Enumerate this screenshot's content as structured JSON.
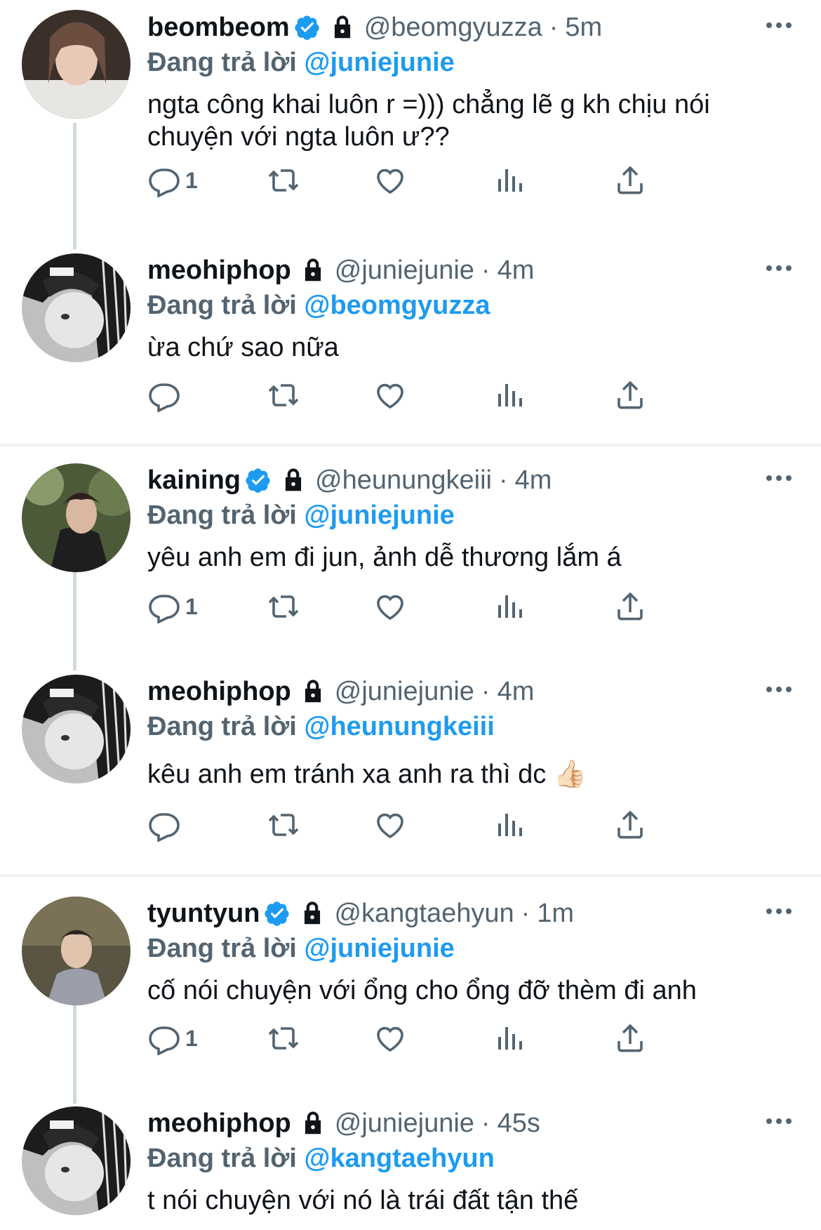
{
  "tweets": [
    {
      "name": "beombeom",
      "verified": true,
      "handle": "@beomgyuzza",
      "time": "5m",
      "replying_prefix": "Đang trả lời",
      "replying_to": "@juniejunie",
      "text": "ngta công khai luôn r =))) chẳng lẽ g kh chịu nói chuyện với ngta luôn ư??",
      "reply_count": "1"
    },
    {
      "name": "meohiphop",
      "verified": false,
      "handle": "@juniejunie",
      "time": "4m",
      "replying_prefix": "Đang trả lời",
      "replying_to": "@beomgyuzza",
      "text": "ừa chứ sao nữa",
      "reply_count": ""
    },
    {
      "name": "kaining",
      "verified": true,
      "handle": "@heunungkeiii",
      "time": "4m",
      "replying_prefix": "Đang trả lời",
      "replying_to": "@juniejunie",
      "text": "yêu anh em đi jun, ảnh dễ thương lắm á",
      "reply_count": "1"
    },
    {
      "name": "meohiphop",
      "verified": false,
      "handle": "@juniejunie",
      "time": "4m",
      "replying_prefix": "Đang trả lời",
      "replying_to": "@heunungkeiii",
      "text": "kêu anh em tránh xa anh ra thì dc 👍🏻",
      "reply_count": ""
    },
    {
      "name": "tyuntyun",
      "verified": true,
      "handle": "@kangtaehyun",
      "time": "1m",
      "replying_prefix": "Đang trả lời",
      "replying_to": "@juniejunie",
      "text": "cố nói chuyện với ổng cho ổng đỡ thèm đi anh",
      "reply_count": "1"
    },
    {
      "name": "meohiphop",
      "verified": false,
      "handle": "@juniejunie",
      "time": "45s",
      "replying_prefix": "Đang trả lời",
      "replying_to": "@kangtaehyun",
      "text": "t nói chuyện với nó là trái đất tận thế",
      "reply_count": ""
    }
  ],
  "colors": {
    "accent": "#1d9bf0",
    "secondary_text": "#536471",
    "primary_text": "#0f1419",
    "divider": "#eff3f4",
    "thread_line": "#cfd9de"
  },
  "icons": [
    "verified-badge-icon",
    "lock-icon",
    "more-icon",
    "reply-icon",
    "retweet-icon",
    "like-icon",
    "views-icon",
    "share-icon"
  ]
}
